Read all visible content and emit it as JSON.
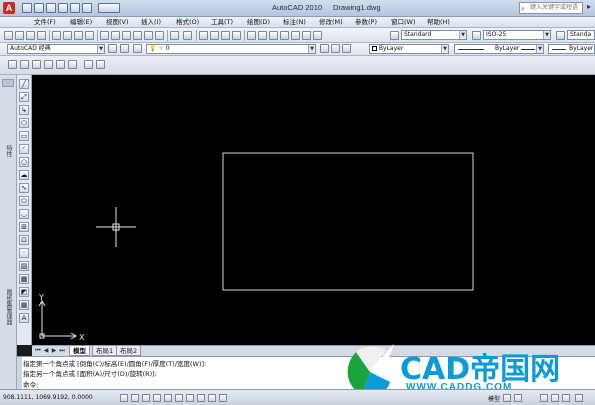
{
  "window": {
    "app_title": "AutoCAD 2010",
    "doc_title": "Drawing1.dwg",
    "search_placeholder": "键入关键字或短语"
  },
  "menu": [
    "文件(F)",
    "编辑(E)",
    "视图(V)",
    "插入(I)",
    "格式(O)",
    "工具(T)",
    "绘图(D)",
    "标注(N)",
    "修改(M)",
    "参数(P)",
    "窗口(W)",
    "帮助(H)"
  ],
  "toolbar": {
    "text_style": "Standard",
    "dim_style": "ISO-25",
    "table_style": "Standa"
  },
  "workspace": {
    "name": "AutoCAD 经典",
    "layer": "0",
    "color": "ByLayer",
    "linetype": "ByLayer",
    "lineweight": "ByLayer"
  },
  "palettes": {
    "left_label_top": "特性",
    "left_label_bottom": "图纸集管理器"
  },
  "canvas": {
    "ucs_x": "X",
    "ucs_y": "Y"
  },
  "layout_tabs": [
    "模型",
    "布局1",
    "布局2"
  ],
  "active_tab": "模型",
  "command": {
    "line1": "指定第一个角点或 [倒角(C)/标高(E)/圆角(F)/厚度(T)/宽度(W)]:",
    "line2": "指定另一个角点或 [面积(A)/尺寸(D)/旋转(R)]:",
    "prompt": "命令:"
  },
  "status": {
    "coords": "908.1111, 1069.9192, 0.0000",
    "model_label": "模型"
  },
  "watermark": {
    "text": "CAD帝国网",
    "url": "WWW.CADDG.COM"
  },
  "colors": {
    "canvas": "#000000",
    "rectangle": "#d8d8d8",
    "watermark": "#0a9bd8"
  }
}
